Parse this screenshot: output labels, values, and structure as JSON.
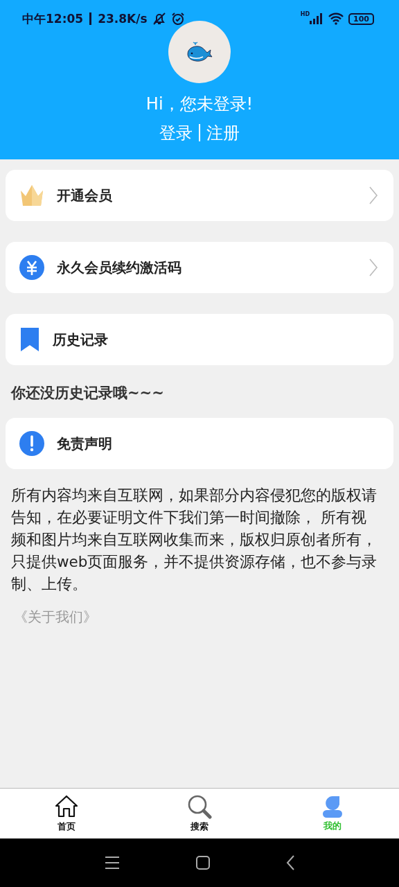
{
  "status_bar": {
    "time": "中午12:05",
    "speed": "23.8K/s",
    "network": "HD",
    "battery": "100"
  },
  "header": {
    "greeting": "Hi，您未登录!",
    "login": "登录",
    "separator": "|",
    "register": "注册"
  },
  "content": [
    {
      "kind": "card",
      "label": "开通会员",
      "chevron": true
    },
    {
      "kind": "card",
      "label": "永久会员续约激活码",
      "chevron": true
    },
    {
      "kind": "card",
      "label": "历史记录",
      "chevron": false
    },
    {
      "kind": "heading",
      "text": "你还没历史记录哦~~~"
    },
    {
      "kind": "card",
      "label": "免责声明",
      "chevron": false
    },
    {
      "kind": "paragraph",
      "text": "所有内容均来自互联网，如果部分内容侵犯您的版权请告知，在必要证明文件下我们第一时间撤除， 所有视频和图片均来自互联网收集而来，版权归原创者所有，只提供web页面服务，并不提供资源存储，也不参与录制、上传。"
    },
    {
      "kind": "link",
      "text": "《关于我们》"
    }
  ],
  "tabs": [
    {
      "label": "首页",
      "selected": false
    },
    {
      "label": "搜索",
      "selected": false
    },
    {
      "label": "我的",
      "selected": true
    }
  ]
}
